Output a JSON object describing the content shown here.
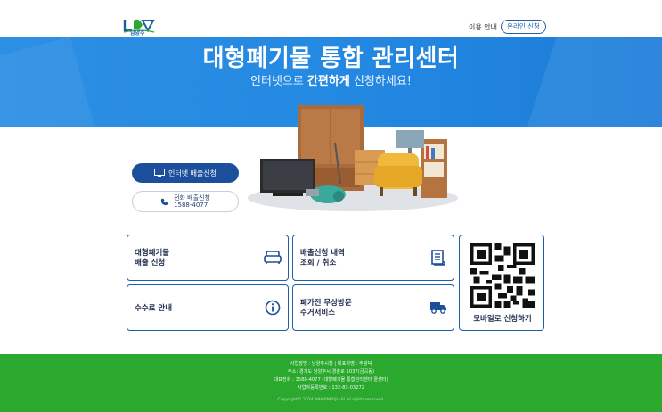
{
  "header": {
    "logo_text": "남양주",
    "nav_guide": "이용 안내",
    "nav_apply": "온라인 신청"
  },
  "hero": {
    "title": "대형폐기물 통합 관리센터",
    "subtitle_pre": "인터넷으로 ",
    "subtitle_bold": "간편하게",
    "subtitle_post": " 신청하세요!"
  },
  "actions": {
    "internet_label": "인터넷 배출신청",
    "phone_label": "전화 배출신청",
    "phone_number": "1588-4077"
  },
  "cards": {
    "apply_line1": "대형폐기물",
    "apply_line2": "배출 신청",
    "history_line1": "배출신청 내역",
    "history_line2": "조회 / 취소",
    "fee": "수수료 안내",
    "visit_line1": "폐가전 무상방문",
    "visit_line2": "수거서비스",
    "mobile": "모바일로 신청하기"
  },
  "footer": {
    "line1": "사업장명 : 남양주시청 | 대표자명 : 주광덕",
    "line2": "주소: 경기도 남양주시 경춘로 1037(금곡동)",
    "line3": "대표전화 : 1588-4077 (대형폐기물 통합관리센터 콜센터)",
    "line4": "사업자등록번호 : 132-83-03272",
    "copyright": "Copyright© 2024 NAMYANGJU-SI all rights reserved."
  },
  "colors": {
    "primary": "#1b4f9c",
    "hero_blue": "#2489e2",
    "footer_green": "#2aa92e"
  }
}
